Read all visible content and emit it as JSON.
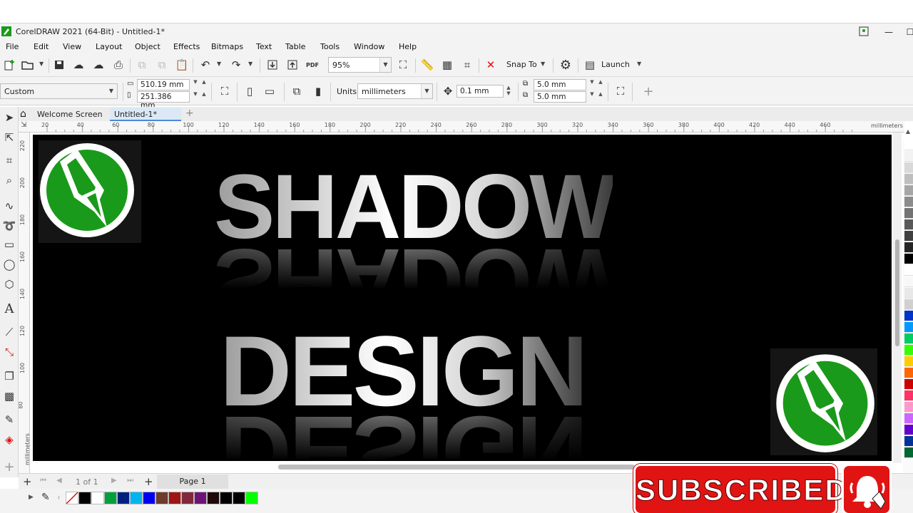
{
  "window": {
    "title": "CorelDRAW 2021 (64-Bit) - Untitled-1*",
    "minimize": "—",
    "maximize": "☐"
  },
  "menu": [
    "File",
    "Edit",
    "View",
    "Layout",
    "Object",
    "Effects",
    "Bitmaps",
    "Text",
    "Table",
    "Tools",
    "Window",
    "Help"
  ],
  "toolbar": {
    "pdf_label": "PDF",
    "zoom": "95%",
    "snap_to": "Snap To",
    "launch": "Launch"
  },
  "propbar": {
    "page_size": "Custom",
    "width": "510.19 mm",
    "height": "251.386 mm",
    "units_label": "Units:",
    "units": "millimeters",
    "nudge": "0.1 mm",
    "dup_x": "5.0 mm",
    "dup_y": "5.0 mm"
  },
  "tabs": {
    "welcome": "Welcome Screen",
    "document": "Untitled-1*"
  },
  "hruler": {
    "ticks": [
      "20",
      "40",
      "60",
      "80",
      "100",
      "120",
      "140",
      "160",
      "180",
      "200",
      "220",
      "240",
      "260",
      "280",
      "300",
      "320",
      "340",
      "360",
      "380",
      "400",
      "420",
      "440",
      "460"
    ],
    "unit": "millimeters"
  },
  "vruler": {
    "ticks": [
      "220",
      "200",
      "180",
      "160",
      "140",
      "120",
      "100",
      "80"
    ],
    "unit": "millimeters"
  },
  "artwork": {
    "line1": "SHADOW",
    "line2": "DESIGN"
  },
  "pagenav": {
    "counter": "1 of 1",
    "page_tab": "Page 1"
  },
  "overlay": {
    "subscribed": "SUBSCRIBED"
  },
  "colors": {
    "logo_green": "#1a9a1a",
    "subscribe_red": "#e11414",
    "palette_right": [
      "#ffffff",
      "#f2f2f2",
      "#d9d9d9",
      "#bfbfbf",
      "#a6a6a6",
      "#8c8c8c",
      "#737373",
      "#595959",
      "#404040",
      "#262626",
      "#000000",
      "#ffffff",
      "#f8f8f8",
      "#e8e8e8",
      "#d0d0d0",
      "#0033cc",
      "#0099ff",
      "#00cc66",
      "#33ff00",
      "#ffcc00",
      "#ff6600",
      "#cc0000",
      "#ff3366",
      "#ff99cc",
      "#cc66ff",
      "#6600cc",
      "#003399",
      "#006633"
    ],
    "palette_bottom": [
      "#ffffff",
      "#000000",
      "#ffffff",
      "#00a03c",
      "#002080",
      "#00b4f0",
      "#0000f0",
      "#6e3c28",
      "#a01414",
      "#82283c",
      "#6e1478",
      "#1e0a0a",
      "#000000",
      "#000000",
      "#00ff00"
    ]
  }
}
